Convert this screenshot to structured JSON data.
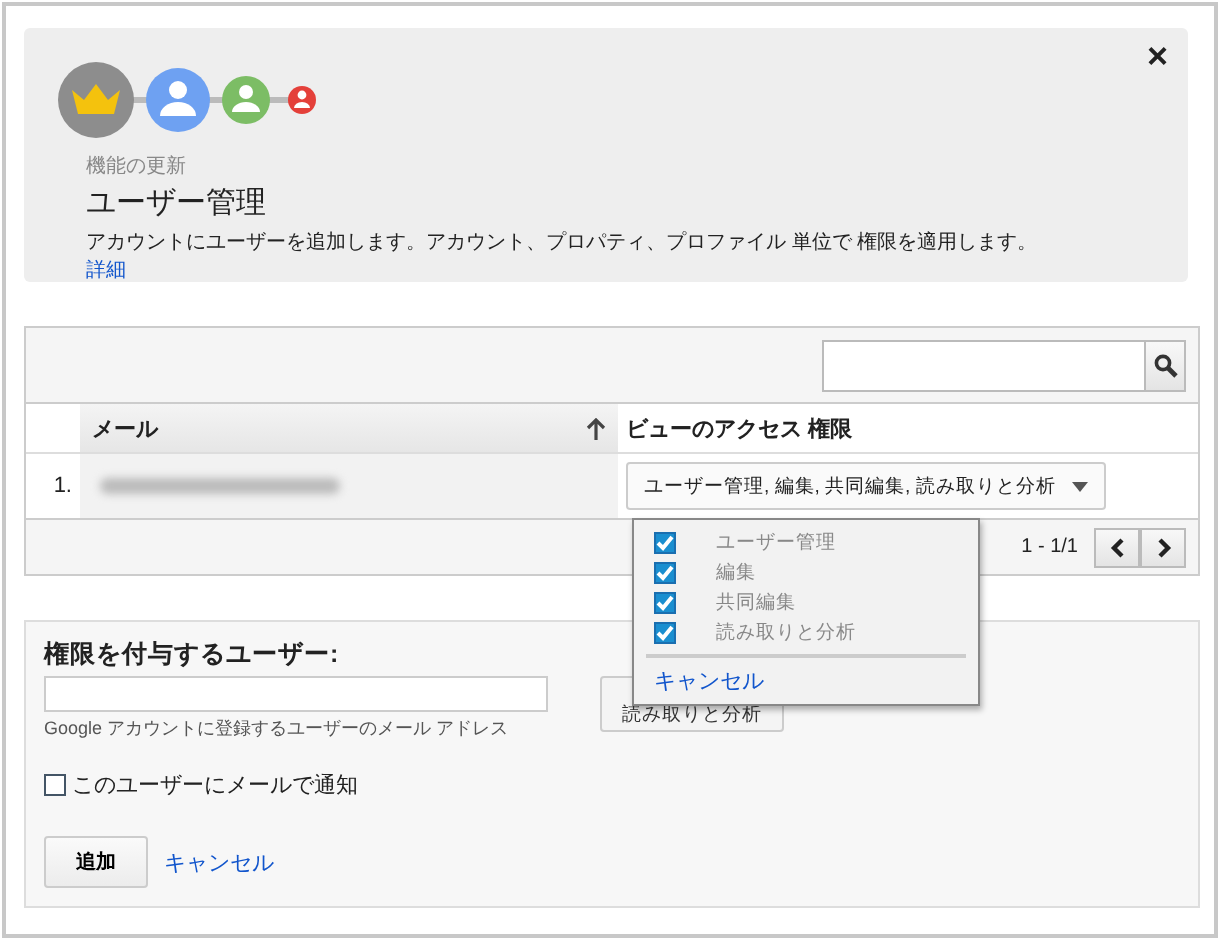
{
  "close": "×",
  "header": {
    "eyebrow": "機能の更新",
    "title": "ユーザー管理",
    "description": "アカウントにユーザーを追加します。アカウント、プロパティ、プロファイル 単位で 権限を適用します。",
    "link": "詳細"
  },
  "table": {
    "columns": [
      {
        "label": "メール"
      },
      {
        "label": "ビューのアクセス 権限"
      }
    ],
    "rows": [
      {
        "index": "1.",
        "permissions": "ユーザー管理, 編集, 共同編集, 読み取りと分析"
      }
    ],
    "pagination": "1 - 1/1"
  },
  "permission_menu": {
    "options": [
      {
        "label": "ユーザー管理",
        "checked": true
      },
      {
        "label": "編集",
        "checked": true
      },
      {
        "label": "共同編集",
        "checked": true
      },
      {
        "label": "読み取りと分析",
        "checked": true
      }
    ],
    "cancel": "キャンセル"
  },
  "add_form": {
    "title": "権限を付与するユーザー:",
    "hint": "Google アカウントに登録するユーザーのメール アドレス",
    "role": "読み取りと分析",
    "notify": {
      "label": "このユーザーにメールで通知",
      "checked": false
    },
    "submit": "追加",
    "cancel": "キャンセル"
  }
}
